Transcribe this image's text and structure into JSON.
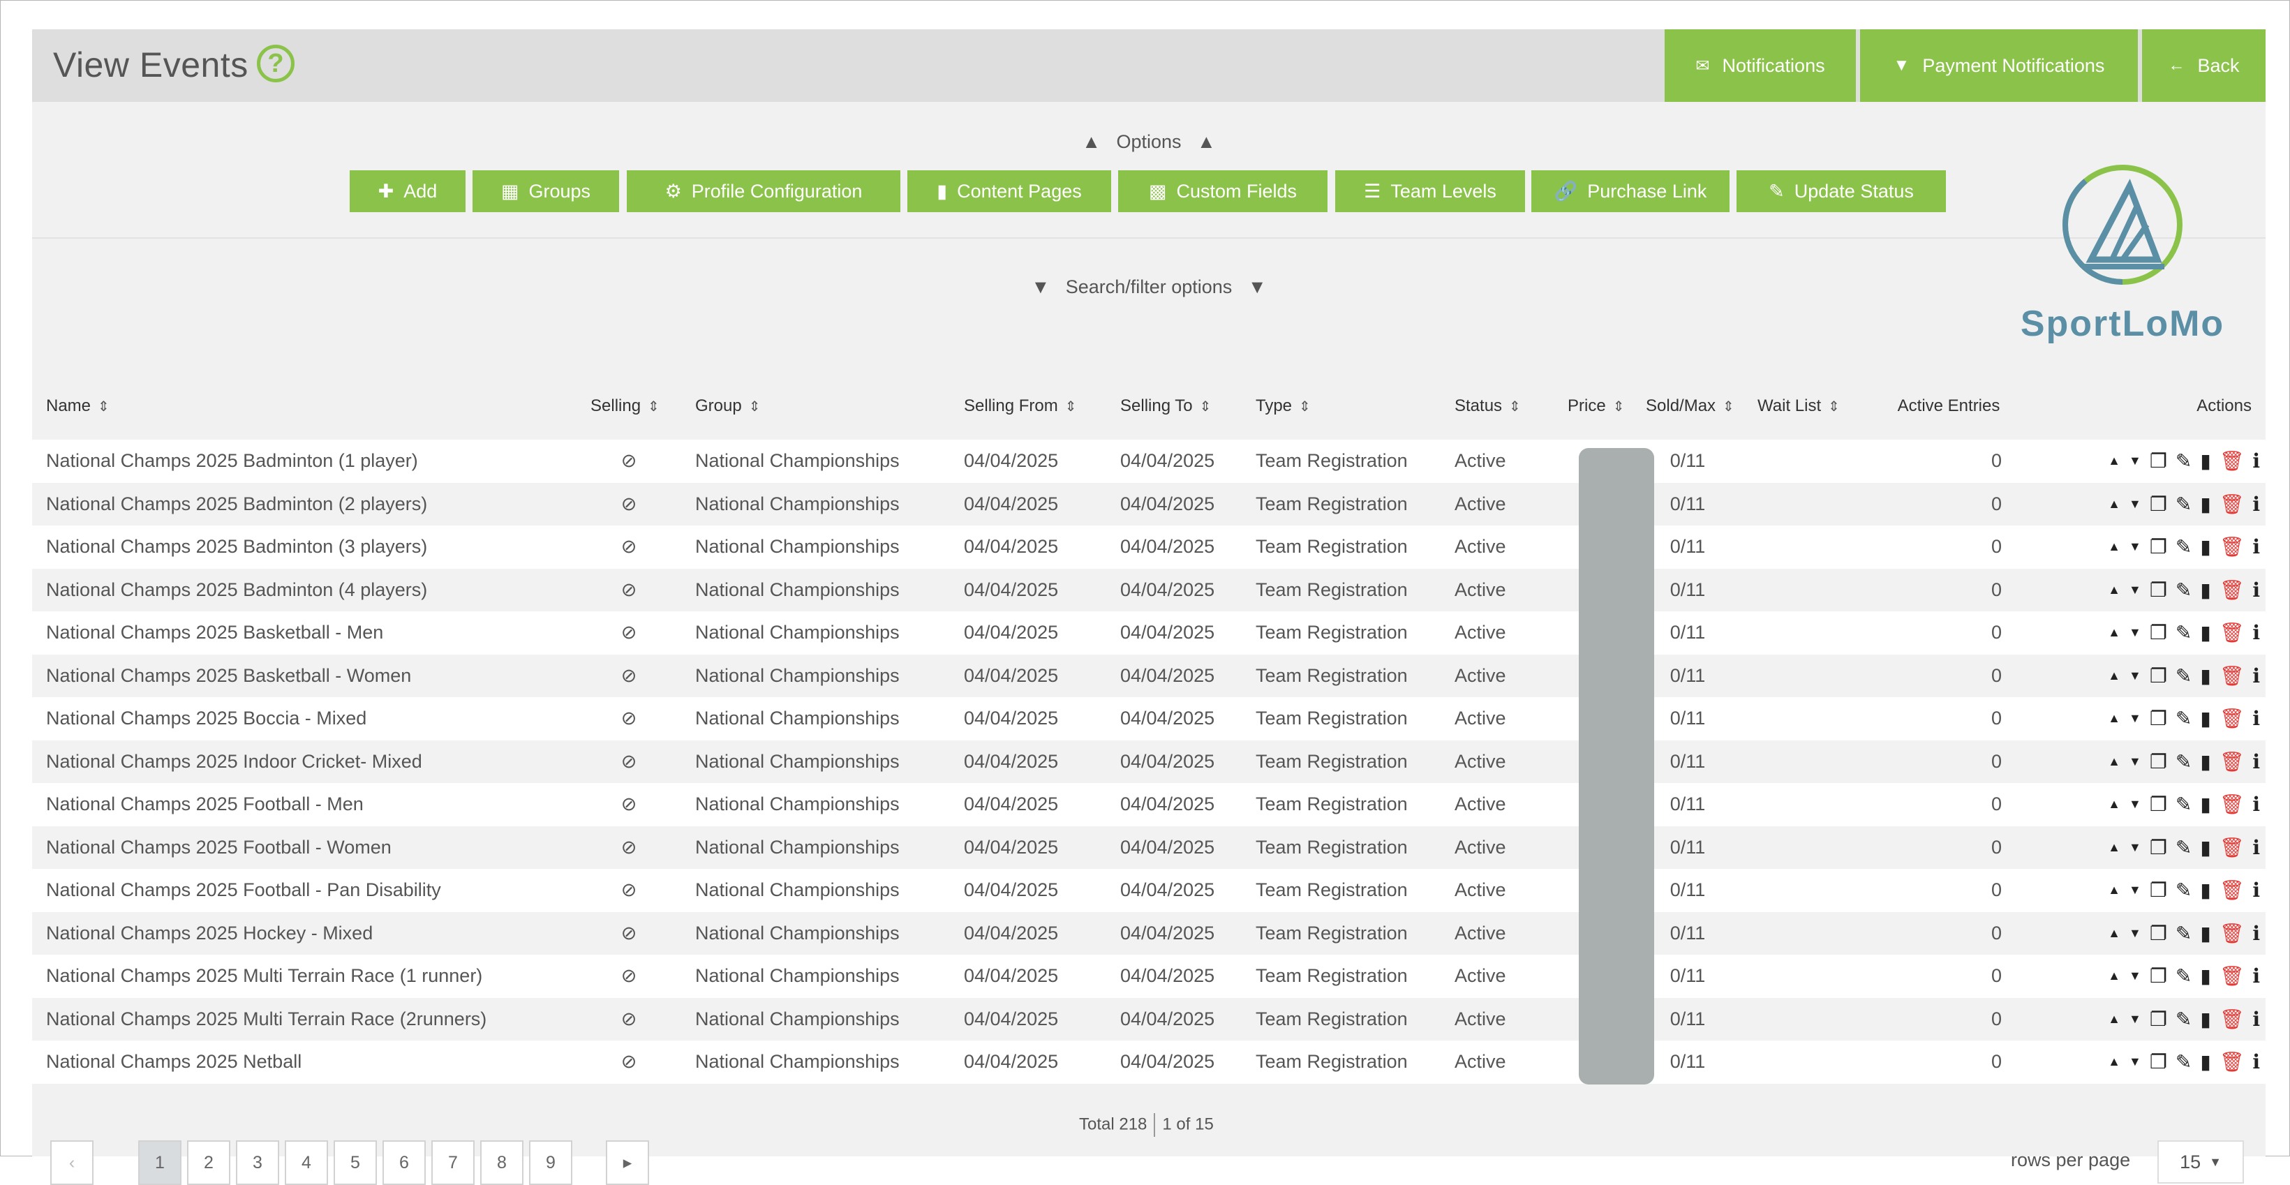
{
  "header": {
    "title": "View Events",
    "help_icon": "question-circle-icon",
    "notifications_label": "Notifications",
    "payment_notifications_label": "Payment Notifications",
    "back_label": "Back"
  },
  "options": {
    "toggle_label": "Options",
    "buttons": [
      {
        "label": "Add",
        "icon": "plus-icon"
      },
      {
        "label": "Groups",
        "icon": "table-icon"
      },
      {
        "label": "Profile Configuration",
        "icon": "cogs-icon"
      },
      {
        "label": "Content Pages",
        "icon": "file-icon"
      },
      {
        "label": "Custom Fields",
        "icon": "sitemap-icon"
      },
      {
        "label": "Team Levels",
        "icon": "list-icon"
      },
      {
        "label": "Purchase Link",
        "icon": "link-icon"
      },
      {
        "label": "Update Status",
        "icon": "edit-icon"
      }
    ]
  },
  "search": {
    "toggle_label": "Search/filter options"
  },
  "logo": {
    "text": "SportLoMo"
  },
  "table": {
    "headers": {
      "name": "Name",
      "selling": "Selling",
      "group": "Group",
      "selling_from": "Selling From",
      "selling_to": "Selling To",
      "type": "Type",
      "status": "Status",
      "price": "Price",
      "sold_max": "Sold/Max",
      "wait_list": "Wait List",
      "active_entries": "Active Entries",
      "actions": "Actions"
    },
    "rows": [
      {
        "name": "National Champs 2025 Badminton (1 player)",
        "group": "National Championships",
        "from": "04/04/2025",
        "to": "04/04/2025",
        "type": "Team Registration",
        "status": "Active",
        "sold": "0/11",
        "active": "0"
      },
      {
        "name": "National Champs 2025 Badminton (2 players)",
        "group": "National Championships",
        "from": "04/04/2025",
        "to": "04/04/2025",
        "type": "Team Registration",
        "status": "Active",
        "sold": "0/11",
        "active": "0"
      },
      {
        "name": "National Champs 2025 Badminton (3 players)",
        "group": "National Championships",
        "from": "04/04/2025",
        "to": "04/04/2025",
        "type": "Team Registration",
        "status": "Active",
        "sold": "0/11",
        "active": "0"
      },
      {
        "name": "National Champs 2025 Badminton (4 players)",
        "group": "National Championships",
        "from": "04/04/2025",
        "to": "04/04/2025",
        "type": "Team Registration",
        "status": "Active",
        "sold": "0/11",
        "active": "0"
      },
      {
        "name": "National Champs 2025 Basketball - Men",
        "group": "National Championships",
        "from": "04/04/2025",
        "to": "04/04/2025",
        "type": "Team Registration",
        "status": "Active",
        "sold": "0/11",
        "active": "0"
      },
      {
        "name": "National Champs 2025 Basketball - Women",
        "group": "National Championships",
        "from": "04/04/2025",
        "to": "04/04/2025",
        "type": "Team Registration",
        "status": "Active",
        "sold": "0/11",
        "active": "0"
      },
      {
        "name": "National Champs 2025 Boccia - Mixed",
        "group": "National Championships",
        "from": "04/04/2025",
        "to": "04/04/2025",
        "type": "Team Registration",
        "status": "Active",
        "sold": "0/11",
        "active": "0"
      },
      {
        "name": "National Champs 2025 Indoor Cricket- Mixed",
        "group": "National Championships",
        "from": "04/04/2025",
        "to": "04/04/2025",
        "type": "Team Registration",
        "status": "Active",
        "sold": "0/11",
        "active": "0"
      },
      {
        "name": "National Champs 2025 Football - Men",
        "group": "National Championships",
        "from": "04/04/2025",
        "to": "04/04/2025",
        "type": "Team Registration",
        "status": "Active",
        "sold": "0/11",
        "active": "0"
      },
      {
        "name": "National Champs 2025 Football - Women",
        "group": "National Championships",
        "from": "04/04/2025",
        "to": "04/04/2025",
        "type": "Team Registration",
        "status": "Active",
        "sold": "0/11",
        "active": "0"
      },
      {
        "name": "National Champs 2025 Football - Pan Disability",
        "group": "National Championships",
        "from": "04/04/2025",
        "to": "04/04/2025",
        "type": "Team Registration",
        "status": "Active",
        "sold": "0/11",
        "active": "0"
      },
      {
        "name": "National Champs 2025 Hockey - Mixed",
        "group": "National Championships",
        "from": "04/04/2025",
        "to": "04/04/2025",
        "type": "Team Registration",
        "status": "Active",
        "sold": "0/11",
        "active": "0"
      },
      {
        "name": "National Champs 2025 Multi Terrain Race (1 runner)",
        "group": "National Championships",
        "from": "04/04/2025",
        "to": "04/04/2025",
        "type": "Team Registration",
        "status": "Active",
        "sold": "0/11",
        "active": "0"
      },
      {
        "name": "National Champs 2025 Multi Terrain Race (2runners)",
        "group": "National Championships",
        "from": "04/04/2025",
        "to": "04/04/2025",
        "type": "Team Registration",
        "status": "Active",
        "sold": "0/11",
        "active": "0"
      },
      {
        "name": "National Champs 2025 Netball",
        "group": "National Championships",
        "from": "04/04/2025",
        "to": "04/04/2025",
        "type": "Team Registration",
        "status": "Active",
        "sold": "0/11",
        "active": "0"
      }
    ]
  },
  "footer": {
    "total": "Total 218",
    "page_of": "1 of 15",
    "pages": [
      "1",
      "2",
      "3",
      "4",
      "5",
      "6",
      "7",
      "8",
      "9"
    ],
    "rows_per_page_label": "rows per page",
    "rows_per_page_value": "15"
  },
  "colors": {
    "accent_green": "#8bc34a",
    "delete_red": "#e53935",
    "logo_blue": "#5b8fa6"
  }
}
